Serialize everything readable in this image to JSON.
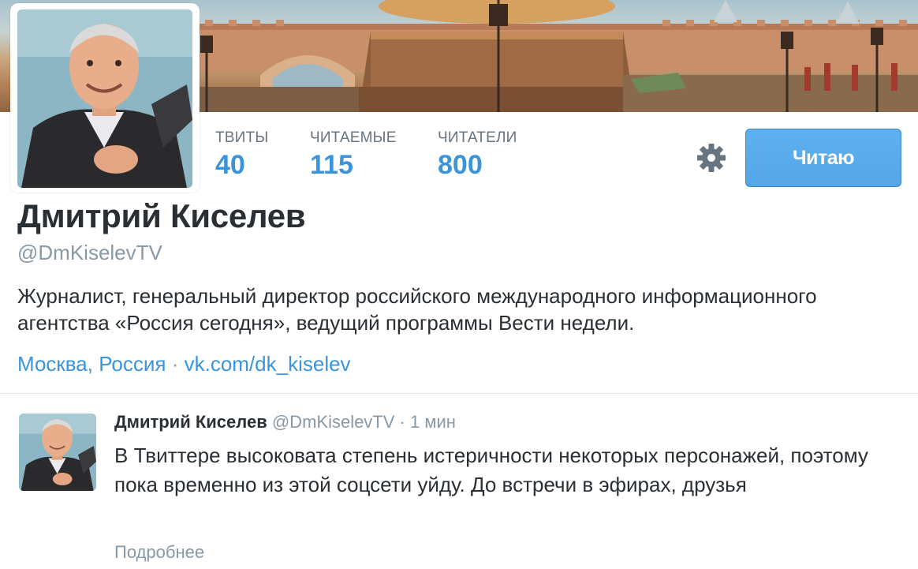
{
  "profile": {
    "display_name": "Дмитрий Киселев",
    "screen_name": "@DmKiselevTV",
    "bio": "Журналист, генеральный директор российского международного информационного агентства «Россия сегодня», ведущий программы Вести недели.",
    "location": "Москва, Россия",
    "meta_separator": " · ",
    "link": "vk.com/dk_kiselev"
  },
  "stats": [
    {
      "label": "ТВИТЫ",
      "value": "40"
    },
    {
      "label": "ЧИТАЕМЫЕ",
      "value": "115"
    },
    {
      "label": "ЧИТАТЕЛИ",
      "value": "800"
    }
  ],
  "actions": {
    "settings_icon": "gear-icon",
    "follow_label": "Читаю"
  },
  "tweet": {
    "author_name": "Дмитрий Киселев",
    "author_handle": "@DmKiselevTV",
    "separator": " · ",
    "time": "1 мин",
    "text": "В Твиттере высоковата степень истеричности некоторых персонажей, поэтому пока временно из этой соцсети уйду. До встречи в эфирах, друзья",
    "more_label": "Подробнее"
  },
  "colors": {
    "link": "#3b94d9",
    "muted": "#8899a6",
    "text": "#292f33",
    "follow_button": "#55acee"
  }
}
